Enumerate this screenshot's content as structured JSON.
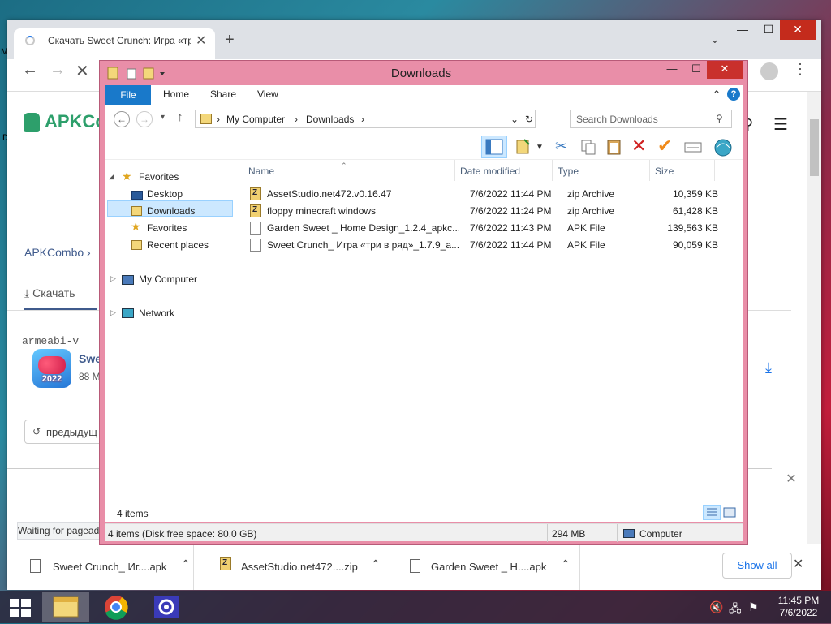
{
  "desktop": {
    "edge_text_1": "M",
    "edge_text_2": "D"
  },
  "browser": {
    "tab_title": "Скачать Sweet Crunch: Игра «тр",
    "tab_close": "✕",
    "new_tab": "+",
    "tab_search": "⌄",
    "window_controls": {
      "minimize": "—",
      "maximize": "☐",
      "close": "✕"
    },
    "nav": {
      "back": "←",
      "forward": "→",
      "stop": "✕"
    },
    "menu": "⋮",
    "status_text": "Waiting for pageads...",
    "page": {
      "logo_text": "APKCo",
      "search_icon": "⚲",
      "hamburger": "☰",
      "breadcrumb": "APKCombo  ›",
      "download_tab": "Скачать",
      "download_tab_icon": "⤓",
      "architecture": "armeabi-v",
      "app_name": "Swe",
      "app_size": "88 M",
      "app_icon_year": "2022",
      "download_arrow": "⤓",
      "prev_button": "предыдущ",
      "prev_icon": "↺",
      "banner_close": "✕"
    },
    "download_shelf": {
      "items": [
        {
          "name": "Sweet Crunch_ Иг....apk",
          "caret": "⌃"
        },
        {
          "name": "AssetStudio.net472....zip",
          "caret": "⌃"
        },
        {
          "name": "Garden Sweet _ H....apk",
          "caret": "⌃"
        }
      ],
      "show_all": "Show all",
      "close": "✕"
    }
  },
  "explorer": {
    "title": "Downloads",
    "controls": {
      "minimize": "—",
      "maximize": "☐",
      "close": "✕"
    },
    "ribbon_tabs": [
      "File",
      "Home",
      "Share",
      "View"
    ],
    "ribbon_collapse": "⌃",
    "help": "?",
    "address": {
      "segments": [
        "My Computer",
        "Downloads"
      ],
      "sep": "›",
      "dropdown": "⌄",
      "refresh": "↻"
    },
    "search_placeholder": "Search Downloads",
    "search_icon": "⚲",
    "nav_pane": {
      "favorites_header": "Favorites",
      "favorites": [
        "Desktop",
        "Downloads",
        "Favorites",
        "Recent places"
      ],
      "my_computer": "My Computer",
      "network": "Network"
    },
    "columns": [
      "Name",
      "Date modified",
      "Type",
      "Size"
    ],
    "files": [
      {
        "name": "AssetStudio.net472.v0.16.47",
        "date": "7/6/2022 11:44 PM",
        "type": "zip Archive",
        "size": "10,359 KB",
        "icon": "zip-icon"
      },
      {
        "name": "floppy minecraft windows",
        "date": "7/6/2022 11:24 PM",
        "type": "zip Archive",
        "size": "61,428 KB",
        "icon": "zip-icon"
      },
      {
        "name": "Garden Sweet _ Home Design_1.2.4_apkc...",
        "date": "7/6/2022 11:43 PM",
        "type": "APK File",
        "size": "139,563 KB",
        "icon": "apk-file-icon"
      },
      {
        "name": "Sweet Crunch_ Игра «три в ряд»_1.7.9_a...",
        "date": "7/6/2022 11:44 PM",
        "type": "APK File",
        "size": "90,059 KB",
        "icon": "apk-file-icon"
      }
    ],
    "item_count": "4 items",
    "status": {
      "left": "4 items (Disk free space: 80.0 GB)",
      "size": "294 MB",
      "location": "Computer"
    }
  },
  "taskbar": {
    "clock_time": "11:45 PM",
    "clock_date": "7/6/2022"
  }
}
